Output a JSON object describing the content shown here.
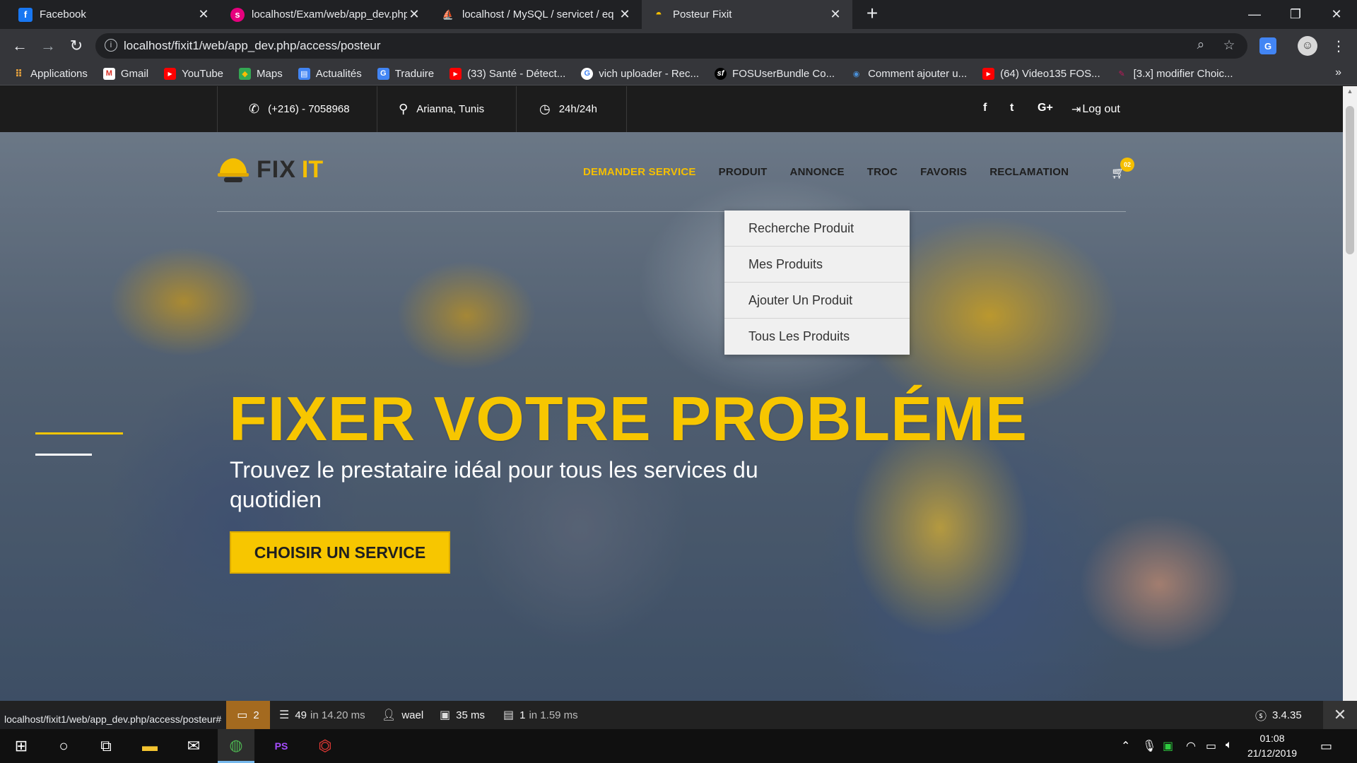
{
  "browser": {
    "tabs": [
      {
        "title": "Facebook",
        "icon": "facebook-icon",
        "active": false
      },
      {
        "title": "localhost/Exam/web/app_dev.php",
        "icon": "symfony-icon",
        "active": false
      },
      {
        "title": "localhost / MySQL / servicet / eq",
        "icon": "phpmyadmin-icon",
        "active": false
      },
      {
        "title": "Posteur Fixit",
        "icon": "helmet-icon",
        "active": true
      }
    ],
    "url": "localhost/fixit1/web/app_dev.php/access/posteur",
    "bookmarks": [
      {
        "label": "Applications",
        "icon": "apps-grid-icon",
        "color": "#e8a33d"
      },
      {
        "label": "Gmail",
        "icon": "gmail-icon",
        "color": "#d93025"
      },
      {
        "label": "YouTube",
        "icon": "youtube-icon",
        "color": "#ff0000"
      },
      {
        "label": "Maps",
        "icon": "maps-icon",
        "color": "#34a853"
      },
      {
        "label": "Actualités",
        "icon": "news-icon",
        "color": "#4285f4"
      },
      {
        "label": "Traduire",
        "icon": "translate-icon",
        "color": "#4285f4"
      },
      {
        "label": "(33) Santé - Détect...",
        "icon": "youtube-icon",
        "color": "#ff0000"
      },
      {
        "label": "vich uploader - Rec...",
        "icon": "google-icon",
        "color": "#ffffff"
      },
      {
        "label": "FOSUserBundle Co...",
        "icon": "symfony-icon",
        "color": "#000000"
      },
      {
        "label": "Comment ajouter u...",
        "icon": "site-icon",
        "color": "#4a90d9"
      },
      {
        "label": "(64) Video135 FOS...",
        "icon": "youtube-icon",
        "color": "#ff0000"
      },
      {
        "label": "[3.x] modifier Choic...",
        "icon": "symfony-icon",
        "color": "#c2185b"
      }
    ]
  },
  "site": {
    "topbar": {
      "phone": "(+216) - 7058968",
      "location": "Arianna, Tunis",
      "hours": "24h/24h",
      "logout": "Log out",
      "social": [
        "f",
        "t",
        "G+"
      ]
    },
    "logo": {
      "part1": "FIX",
      "part2": "IT"
    },
    "nav": [
      {
        "label": "DEMANDER SERVICE",
        "active": true
      },
      {
        "label": "PRODUIT",
        "active": false
      },
      {
        "label": "ANNONCE",
        "active": false
      },
      {
        "label": "TROC",
        "active": false
      },
      {
        "label": "FAVORIS",
        "active": false
      },
      {
        "label": "RECLAMATION",
        "active": false
      }
    ],
    "cart_count": "02",
    "dropdown": [
      "Recherche Produit",
      "Mes Produits",
      "Ajouter Un Produit",
      "Tous Les Produits"
    ],
    "hero": {
      "title": "FIXER VOTRE PROBLÉME",
      "subtitle": "Trouvez le prestataire idéal pour tous les services du quotidien",
      "cta": "CHOISIR UN SERVICE"
    },
    "colors": {
      "accent": "#f7c600",
      "dark": "#1c1c1c"
    }
  },
  "symfony_toolbar": {
    "status_url": "localhost/fixit1/web/app_dev.php/access/posteur#",
    "events": "2",
    "doctrine": "49",
    "doctrine_time": "in 14.20 ms",
    "user": "wael",
    "time": "35 ms",
    "db": "1",
    "db_time": "in 1.59 ms",
    "version": "3.4.35"
  },
  "taskbar": {
    "time": "01:08",
    "date": "21/12/2019"
  }
}
